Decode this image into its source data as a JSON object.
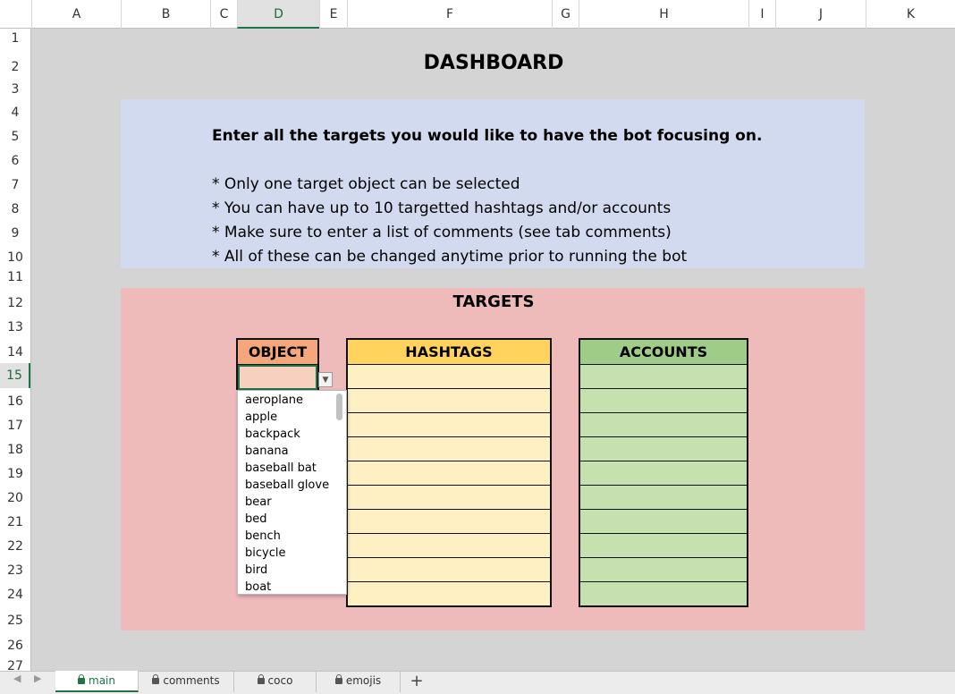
{
  "columns": [
    "A",
    "B",
    "C",
    "D",
    "E",
    "F",
    "G",
    "H",
    "I",
    "J",
    "K"
  ],
  "active_column": "D",
  "rows": [
    "1",
    "2",
    "3",
    "4",
    "5",
    "6",
    "7",
    "8",
    "9",
    "10",
    "11",
    "12",
    "13",
    "14",
    "15",
    "16",
    "17",
    "18",
    "19",
    "20",
    "21",
    "22",
    "23",
    "24",
    "25",
    "26",
    "27"
  ],
  "active_row": "15",
  "dashboard": {
    "title": "DASHBOARD",
    "heading": "Enter all the targets you would like to have the bot focusing on.",
    "bullets": [
      "* Only one target object can be selected",
      "* You can have up to 10 targetted hashtags and/or accounts",
      "* Make sure to enter a list of comments (see tab comments)",
      "* All of these can be changed anytime prior to running the bot"
    ]
  },
  "targets": {
    "title": "TARGETS",
    "object_header": "OBJECT",
    "hashtags_header": "HASHTAGS",
    "accounts_header": "ACCOUNTS",
    "object_value": ""
  },
  "dropdown_options": [
    "aeroplane",
    "apple",
    "backpack",
    "banana",
    "baseball bat",
    "baseball glove",
    "bear",
    "bed",
    "bench",
    "bicycle",
    "bird",
    "boat"
  ],
  "sheet_tabs": [
    "main",
    "comments",
    "coco",
    "emojis"
  ],
  "active_tab": "main",
  "colors": {
    "object_header": "#f4a77b",
    "hashtags_header": "#ffd35c",
    "accounts_header": "#9fcc86",
    "excel_green": "#217346"
  }
}
